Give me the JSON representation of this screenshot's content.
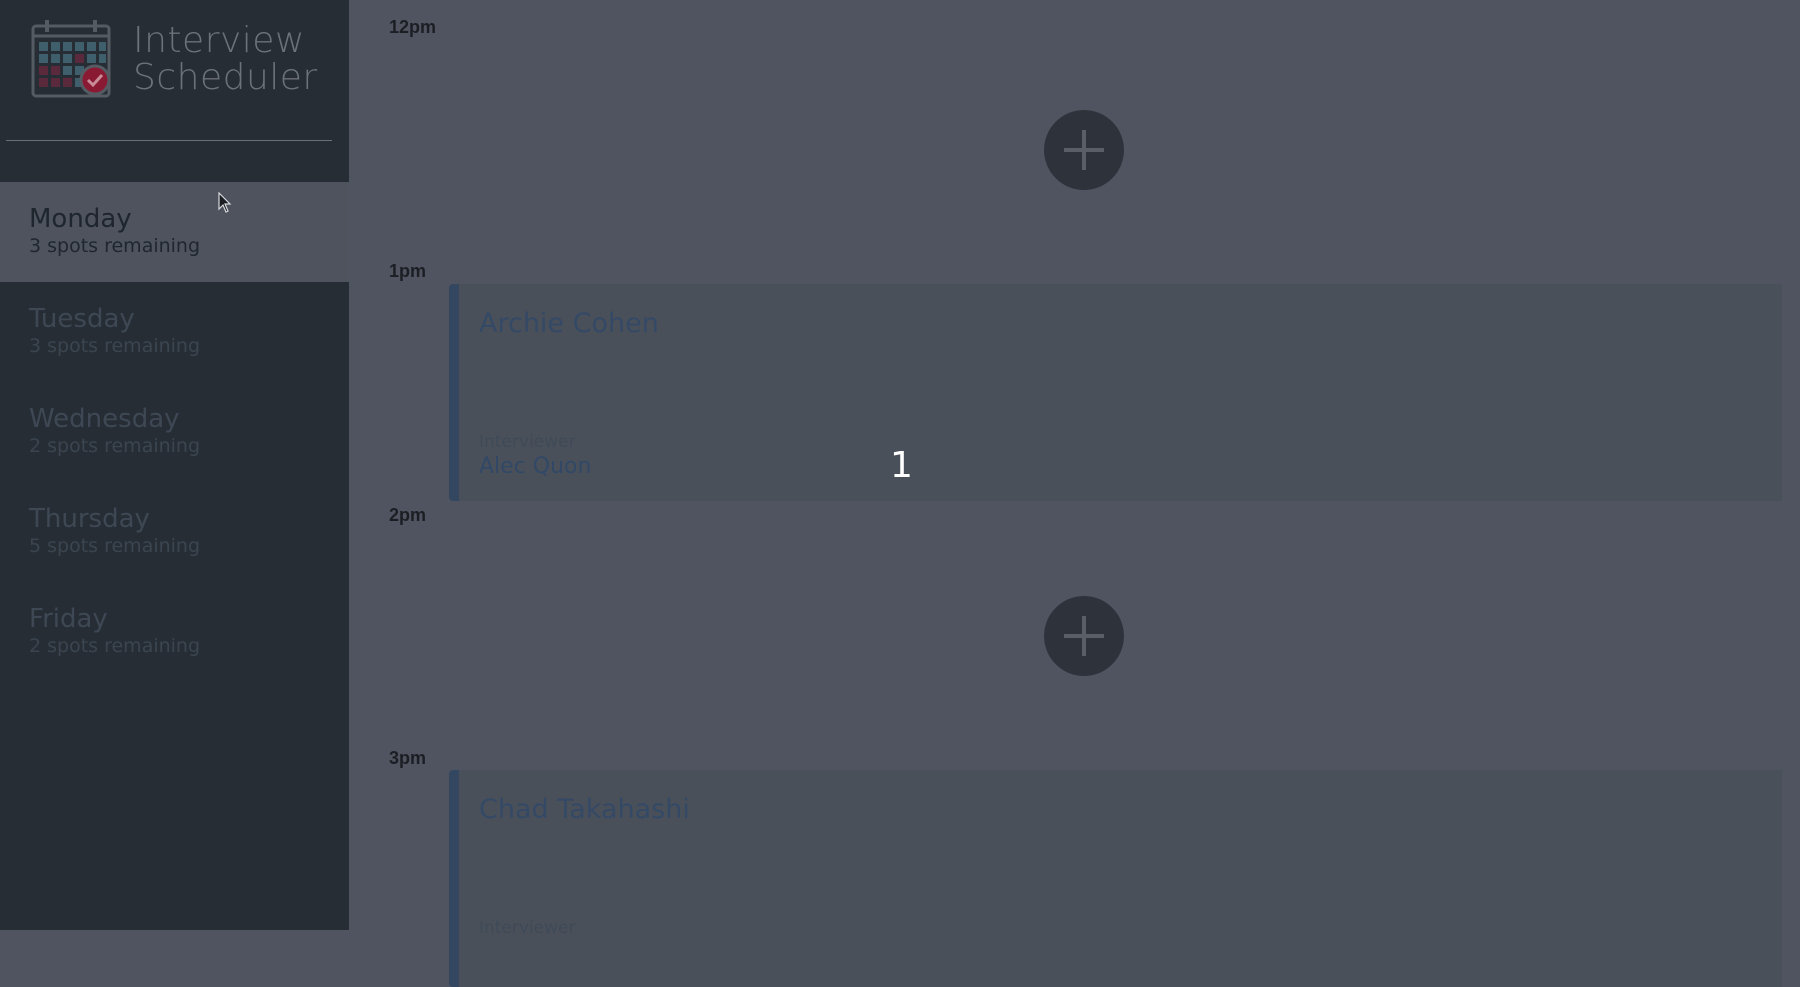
{
  "app": {
    "brand_line1": "Interview",
    "brand_line2": "Scheduler"
  },
  "sidebar": {
    "days": [
      {
        "name": "Monday",
        "spots": "3 spots remaining",
        "selected": true
      },
      {
        "name": "Tuesday",
        "spots": "3 spots remaining"
      },
      {
        "name": "Wednesday",
        "spots": "2 spots remaining"
      },
      {
        "name": "Thursday",
        "spots": "5 spots remaining"
      },
      {
        "name": "Friday",
        "spots": "2 spots remaining"
      }
    ]
  },
  "schedule": {
    "times": [
      "12pm",
      "1pm",
      "2pm",
      "3pm"
    ],
    "appointments": [
      {
        "student": "Archie Cohen",
        "interviewer_label": "Interviewer",
        "interviewer": "Alec Quon"
      },
      {
        "student": "Chad Takahashi",
        "interviewer_label": "Interviewer"
      }
    ]
  },
  "overlay": {
    "number": "1"
  },
  "colors": {
    "sidebar_bg": "#262d35",
    "main_bg": "#4f5460",
    "selected_day_bg": "#4e535d",
    "appointment_accent": "#334761",
    "logo_check": "#8a1a33"
  },
  "icons": {
    "logo": "calendar-check-icon",
    "add": "plus-icon",
    "cursor": "mouse-pointer-icon"
  }
}
